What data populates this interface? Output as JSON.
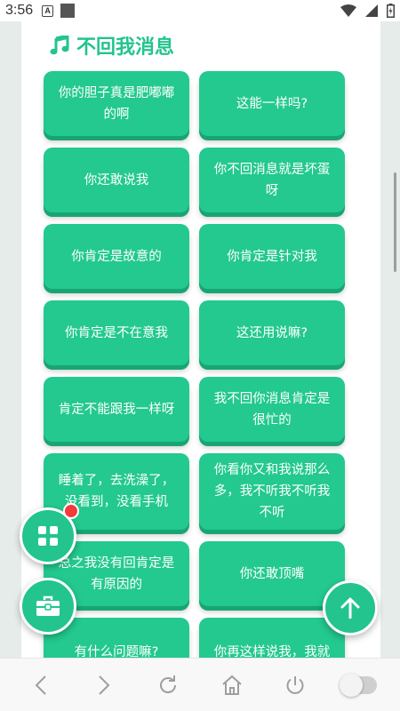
{
  "status_bar": {
    "time": "3:56",
    "notification_letter": "A"
  },
  "section": {
    "title": "不回我消息",
    "icon": "music-note-icon",
    "accent_color": "#23c48e"
  },
  "phrases": [
    "你的胆子真是肥嘟嘟的啊",
    "这能一样吗?",
    "你还敢说我",
    "你不回消息就是坏蛋呀",
    "你肯定是故意的",
    "你肯定是针对我",
    "你肯定是不在意我",
    "这还用说嘛?",
    "肯定不能跟我一样呀",
    "我不回你消息肯定是很忙的",
    "睡着了，去洗澡了，没看到，没看手机",
    "你看你又和我说那么多，我不听我不听我不听",
    "总之我没有回肯定是有原因的",
    "你还敢顶嘴",
    "有什么问题嘛?",
    "你再这样说我，我就"
  ],
  "fabs": {
    "apps_icon": "grid-apps-icon",
    "toolbox_icon": "toolbox-icon",
    "scroll_top_icon": "arrow-up-icon",
    "badge_color": "#f23b3b"
  },
  "nav": {
    "back_icon": "chevron-left-icon",
    "forward_icon": "chevron-right-icon",
    "refresh_icon": "refresh-icon",
    "home_icon": "home-icon",
    "power_icon": "power-icon",
    "toggle_icon": "toggle-switch-icon"
  }
}
